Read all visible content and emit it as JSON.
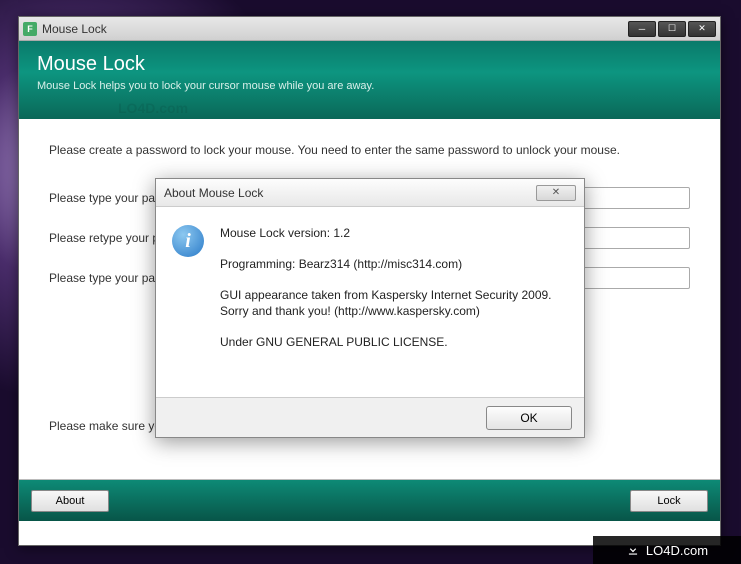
{
  "window": {
    "title": "Mouse Lock",
    "icon_letter": "F"
  },
  "header": {
    "title": "Mouse Lock",
    "subtitle": "Mouse Lock helps you to lock your cursor mouse while you are away."
  },
  "content": {
    "instruction": "Please create a password to lock your mouse. You need to enter the same password to unlock your mouse.",
    "fields": [
      {
        "label": "Please type your pass",
        "value": ""
      },
      {
        "label": "Please retype your pa",
        "value": ""
      },
      {
        "label": "Please type your pass",
        "value": ""
      }
    ],
    "note": "Please make sure your keyboard is working well and you are not using a virtual keyboard."
  },
  "footer": {
    "about": "About",
    "lock": "Lock"
  },
  "dialog": {
    "title": "About Mouse Lock",
    "lines": {
      "version": "Mouse Lock version: 1.2",
      "programming": "Programming: Bearz314 (http://misc314.com)",
      "gui1": "GUI appearance taken from Kaspersky Internet Security 2009.",
      "gui2": "Sorry and thank you! (http://www.kaspersky.com)",
      "license": "Under GNU GENERAL PUBLIC LICENSE."
    },
    "ok": "OK"
  },
  "watermark": {
    "top": "LO4D.com",
    "badge": "LO4D.com"
  }
}
